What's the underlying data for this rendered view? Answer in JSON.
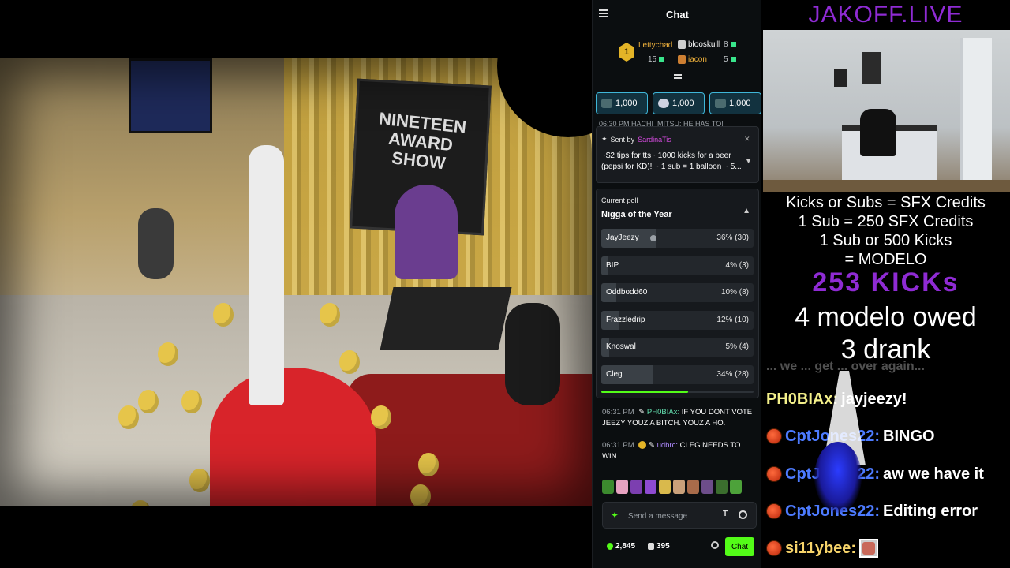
{
  "chat": {
    "title": "Chat",
    "leaderboard": {
      "first": {
        "rank": "1",
        "name": "Lettychad",
        "count": "15"
      },
      "second": {
        "name": "blooskulll",
        "count": "8"
      },
      "third": {
        "name": "iacon",
        "count": "5"
      }
    },
    "kick_cards": [
      {
        "value": "1,000"
      },
      {
        "value": "1,000"
      },
      {
        "value": "1,000"
      }
    ],
    "top_message": "06:30 PM  HACHI_MITSU: HE HAS TO!",
    "pinned": {
      "sent_by_label": "Sent by",
      "sender": "SardinaTis",
      "message": "~$2 tips for tts~ 1000 kicks for a beer (pepsi for KD)! ~ 1 sub = 1 balloon ~ 5..."
    },
    "poll": {
      "label": "Current poll",
      "title": "Nigga of the Year",
      "options": [
        {
          "name": "JayJeezy",
          "pct": 36,
          "display": "36% (30)"
        },
        {
          "name": "BIP",
          "pct": 4,
          "display": "4% (3)"
        },
        {
          "name": "Oddbodd60",
          "pct": 10,
          "display": "10% (8)"
        },
        {
          "name": "Frazzledrip",
          "pct": 12,
          "display": "12% (10)"
        },
        {
          "name": "Knoswal",
          "pct": 5,
          "display": "5% (4)"
        },
        {
          "name": "Cleg",
          "pct": 34,
          "display": "34% (28)"
        }
      ],
      "time_remaining_fraction": 0.57
    },
    "messages": [
      {
        "time": "06:31 PM",
        "user": "PH0BIAx:",
        "text": "IF YOU DONT VOTE JEEZY YOUZ A BITCH. YOUZ A HO."
      },
      {
        "time": "06:31 PM",
        "user": "udbrc:",
        "text": "CLEG NEEDS TO WIN"
      }
    ],
    "input": {
      "placeholder": "Send a message"
    },
    "footer": {
      "viewers": "2,845",
      "kicks": "395",
      "chat_button": "Chat"
    }
  },
  "overlay": {
    "site_title": "JAKOFF.LIVE",
    "rules": [
      "Kicks or Subs = SFX Credits",
      "1 Sub = 250 SFX Credits",
      "1 Sub or 500 Kicks",
      "= MODELO"
    ],
    "kicks_count": "253 KICKs",
    "modelo_owed": "4 modelo owed",
    "drank": "3 drank",
    "faded_line": "... we ... get ... over again...",
    "chat": [
      {
        "user": "PH0BIAx:",
        "text": "jayjeezy!"
      },
      {
        "user": "CptJones22:",
        "text": "BINGO"
      },
      {
        "user": "CptJones22:",
        "text": "aw we have it"
      },
      {
        "user": "CptJones22:",
        "text": "Editing error"
      },
      {
        "user": "si11ybee:",
        "text": ""
      }
    ]
  },
  "main_feed": {
    "board_text": "NINETEEN AWARD SHOW"
  },
  "colors": {
    "kick_green": "#53fc18",
    "overlay_purple": "#8f2bd4",
    "bg": "#000000"
  }
}
